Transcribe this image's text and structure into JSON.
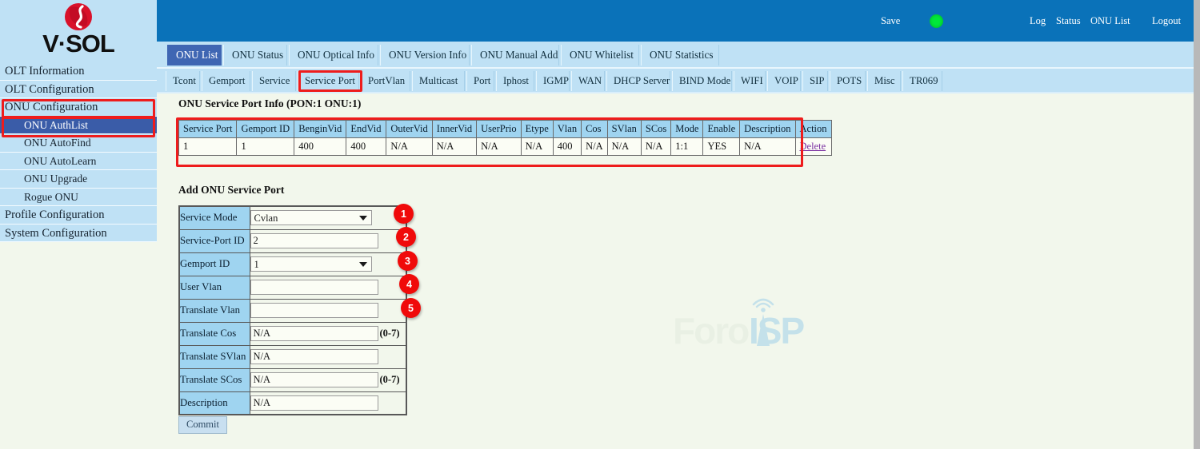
{
  "brand": {
    "name": "V·SOL",
    "logo_icon": "vsol-sphere-logo"
  },
  "sidebar": {
    "items": [
      {
        "label": "OLT Information",
        "level": "top",
        "selected": false
      },
      {
        "label": "OLT Configuration",
        "level": "top",
        "selected": false
      },
      {
        "label": "ONU Configuration",
        "level": "top",
        "selected": false,
        "highlighted": true
      },
      {
        "label": "ONU AuthList",
        "level": "sub",
        "selected": true,
        "highlighted": true
      },
      {
        "label": "ONU AutoFind",
        "level": "sub",
        "selected": false
      },
      {
        "label": "ONU AutoLearn",
        "level": "sub",
        "selected": false
      },
      {
        "label": "ONU Upgrade",
        "level": "sub",
        "selected": false
      },
      {
        "label": "Rogue ONU",
        "level": "sub",
        "selected": false
      },
      {
        "label": "Profile Configuration",
        "level": "top",
        "selected": false
      },
      {
        "label": "System Configuration",
        "level": "top",
        "selected": false
      }
    ]
  },
  "topbar": {
    "save_label": "Save",
    "status_dot_color": "#00e83a",
    "links": [
      "Log",
      "Status",
      "ONU List",
      "Logout"
    ]
  },
  "tabs_primary": [
    {
      "label": "ONU List",
      "active": true
    },
    {
      "label": "ONU Status",
      "active": false
    },
    {
      "label": "ONU Optical Info",
      "active": false
    },
    {
      "label": "ONU Version Info",
      "active": false
    },
    {
      "label": "ONU Manual Add",
      "active": false
    },
    {
      "label": "ONU Whitelist",
      "active": false
    },
    {
      "label": "ONU Statistics",
      "active": false
    }
  ],
  "tabs_secondary": [
    {
      "label": "Tcont",
      "active": false
    },
    {
      "label": "Gemport",
      "active": false
    },
    {
      "label": "Service",
      "active": false
    },
    {
      "label": "Service Port",
      "active": false,
      "highlighted": true
    },
    {
      "label": "PortVlan",
      "active": false
    },
    {
      "label": "Multicast",
      "active": false
    },
    {
      "label": "Port",
      "active": false
    },
    {
      "label": "Iphost",
      "active": false
    },
    {
      "label": "IGMP",
      "active": false
    },
    {
      "label": "WAN",
      "active": false
    },
    {
      "label": "DHCP Server",
      "active": false
    },
    {
      "label": "BIND Mode",
      "active": false
    },
    {
      "label": "WIFI",
      "active": false
    },
    {
      "label": "VOIP",
      "active": false
    },
    {
      "label": "SIP",
      "active": false
    },
    {
      "label": "POTS",
      "active": false
    },
    {
      "label": "Misc",
      "active": false
    },
    {
      "label": "TR069",
      "active": false
    }
  ],
  "info_section": {
    "title": "ONU Service Port Info (PON:1 ONU:1)",
    "columns": [
      "Service Port",
      "Gemport ID",
      "BenginVid",
      "EndVid",
      "OuterVid",
      "InnerVid",
      "UserPrio",
      "Etype",
      "Vlan",
      "Cos",
      "SVlan",
      "SCos",
      "Mode",
      "Enable",
      "Description",
      "Action"
    ],
    "rows": [
      [
        "1",
        "1",
        "400",
        "400",
        "N/A",
        "N/A",
        "N/A",
        "N/A",
        "400",
        "N/A",
        "N/A",
        "N/A",
        "1:1",
        "YES",
        "N/A",
        "Delete"
      ]
    ]
  },
  "add_section": {
    "title": "Add ONU Service Port",
    "fields": [
      {
        "label": "Service Mode",
        "type": "select",
        "value": "Cvlan",
        "suffix": ""
      },
      {
        "label": "Service-Port ID",
        "type": "text",
        "value": "2",
        "suffix": ""
      },
      {
        "label": "Gemport ID",
        "type": "select",
        "value": "1",
        "suffix": ""
      },
      {
        "label": "User Vlan",
        "type": "text",
        "value": "",
        "suffix": ""
      },
      {
        "label": "Translate Vlan",
        "type": "text",
        "value": "",
        "suffix": ""
      },
      {
        "label": "Translate Cos",
        "type": "text",
        "value": "N/A",
        "suffix": "(0-7)"
      },
      {
        "label": "Translate SVlan",
        "type": "text",
        "value": "N/A",
        "suffix": ""
      },
      {
        "label": "Translate SCos",
        "type": "text",
        "value": "N/A",
        "suffix": "(0-7)"
      },
      {
        "label": "Description",
        "type": "text",
        "value": "N/A",
        "suffix": ""
      }
    ],
    "commit_label": "Commit"
  },
  "callouts": [
    {
      "number": "1"
    },
    {
      "number": "2"
    },
    {
      "number": "3"
    },
    {
      "number": "4"
    },
    {
      "number": "5"
    }
  ],
  "watermark": {
    "text_left": "Foro",
    "text_right": "ISP",
    "icon": "antenna-tower-icon"
  },
  "colors": {
    "header_blue": "#0a72b9",
    "tab_blue": "#bfe1f5",
    "active_tab": "#3f66b3",
    "highlight_red": "#ee1c1c",
    "content_bg": "#f2f7ec",
    "table_header": "#9fd4f0",
    "badge_red": "#f00a0a"
  }
}
